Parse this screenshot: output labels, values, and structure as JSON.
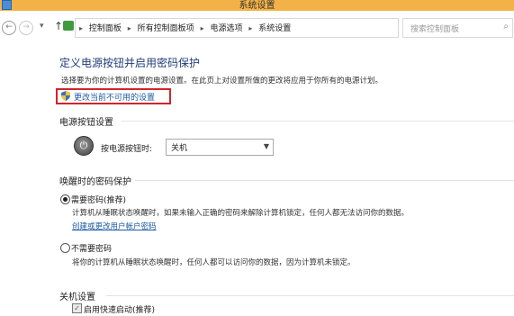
{
  "window": {
    "title": "系统设置"
  },
  "nav": {
    "back": "←",
    "forward": "→",
    "recent": "▾",
    "up": "↑",
    "refresh": "↻",
    "dropdown": "▾"
  },
  "breadcrumb": [
    "控制面板",
    "所有控制面板项",
    "电源选项",
    "系统设置"
  ],
  "search": {
    "placeholder": "搜索控制面板"
  },
  "main": {
    "title": "定义电源按钮并启用密码保护",
    "description": "选择要为你的计算机设置的电源设置。在此页上对设置所做的更改将应用于你所有的电源计划。",
    "change_link": "更改当前不可用的设置",
    "power_section": "电源按钮设置",
    "power_button_label": "按电源按钮时:",
    "power_button_value": "关机",
    "wake_section": "唤醒时的密码保护",
    "require_password": {
      "label": "需要密码(推荐)",
      "note": "计算机从睡眠状态唤醒时，如果未输入正确的密码来解除计算机锁定，任何人都无法访问你的数据。",
      "link": "创建或更改用户帐户密码",
      "selected": true
    },
    "no_password": {
      "label": "不需要密码",
      "note": "将你的计算机从睡眠状态唤醒时，任何人都可以访问你的数据，因为计算机未锁定。",
      "selected": false
    },
    "shutdown_section": "关机设置",
    "fast_startup": {
      "label": "启用快速启动(推荐)",
      "checked": true
    }
  },
  "colors": {
    "titlebar": "#f2b247",
    "link": "#1c5aa6",
    "highlight_border": "#d2242a",
    "heading": "#1f3d7a"
  },
  "icons": [
    "back-icon",
    "forward-icon",
    "up-icon",
    "control-panel-icon",
    "refresh-icon",
    "search-icon",
    "shield-icon",
    "power-icon"
  ]
}
